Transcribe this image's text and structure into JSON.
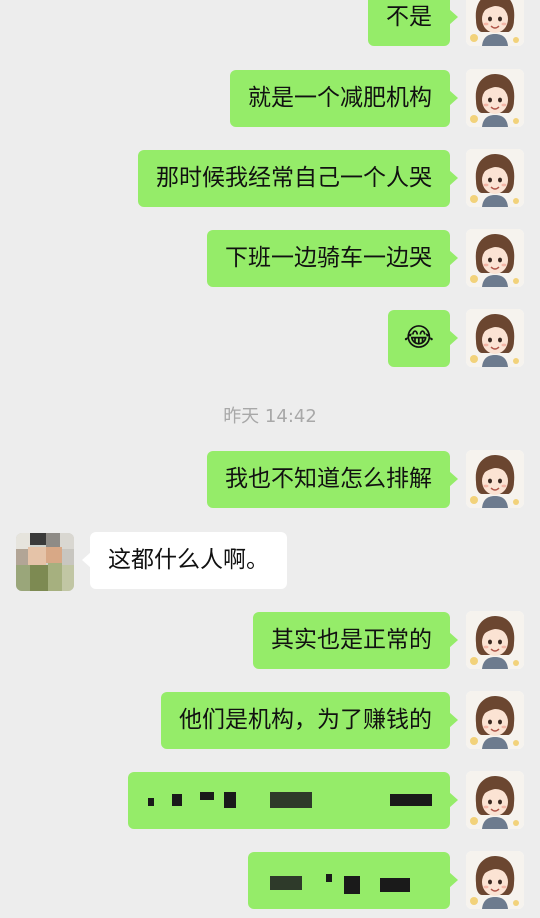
{
  "messages": [
    {
      "side": "me",
      "text": "不是"
    },
    {
      "side": "me",
      "text": "就是一个减肥机构"
    },
    {
      "side": "me",
      "text": "那时候我经常自己一个人哭"
    },
    {
      "side": "me",
      "text": "下班一边骑车一边哭"
    },
    {
      "side": "me",
      "emoji": "😂"
    },
    {
      "side": "other",
      "text": "这都什么人啊。"
    },
    {
      "side": "me",
      "text": "我也不知道怎么排解"
    },
    {
      "side": "me",
      "text": "其实也是正常的"
    },
    {
      "side": "me",
      "text": "他们是机构，为了赚钱的"
    }
  ],
  "timestamp": "昨天 14:42",
  "colors": {
    "background": "#ededed",
    "my_bubble": "#95ec69",
    "other_bubble": "#ffffff"
  },
  "icons": {
    "my_avatar": "cartoon-girl-avatar",
    "other_avatar": "pixelated-avatar",
    "emoji": "laughing-tears-emoji"
  }
}
